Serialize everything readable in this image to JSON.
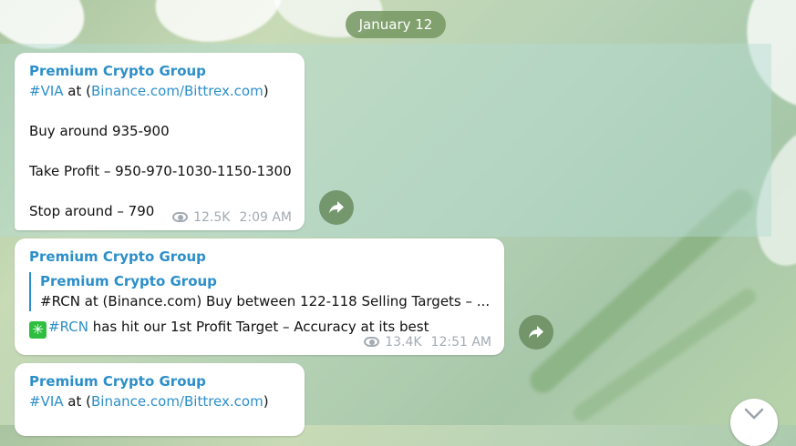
{
  "date_separator": "January 12",
  "messages": [
    {
      "sender": "Premium Crypto Group",
      "tag": "#VIA",
      "at_text": " at (",
      "link": "Binance.com/Bittrex.com",
      "close_paren": ")",
      "buy_line": "Buy around 935-900",
      "take_profit_line": "Take Profit – 950-970-1030-1150-1300",
      "stop_line": "Stop around – 790",
      "views": "12.5K",
      "time": "2:09 AM"
    },
    {
      "sender": "Premium Crypto Group",
      "quote_sender": "Premium Crypto Group",
      "quote_text": "#RCN at (Binance.com)  Buy between 122-118  Selling Targets – ...",
      "emoji": "✳",
      "tag": "#RCN",
      "text": " has hit our 1st Profit Target – Accuracy at its best",
      "views": "13.4K",
      "time": "12:51 AM"
    },
    {
      "sender": "Premium Crypto Group",
      "tag": "#VIA",
      "at_text": " at (",
      "link": "Binance.com/Bittrex.com",
      "close_paren": ")"
    }
  ],
  "icons": {
    "share": "share-arrow-icon",
    "views": "eye-icon",
    "scroll": "chevron-down-icon"
  },
  "colors": {
    "accent": "#2c8fc9",
    "meta": "#a3abb3",
    "date_pill": "#74965f"
  }
}
